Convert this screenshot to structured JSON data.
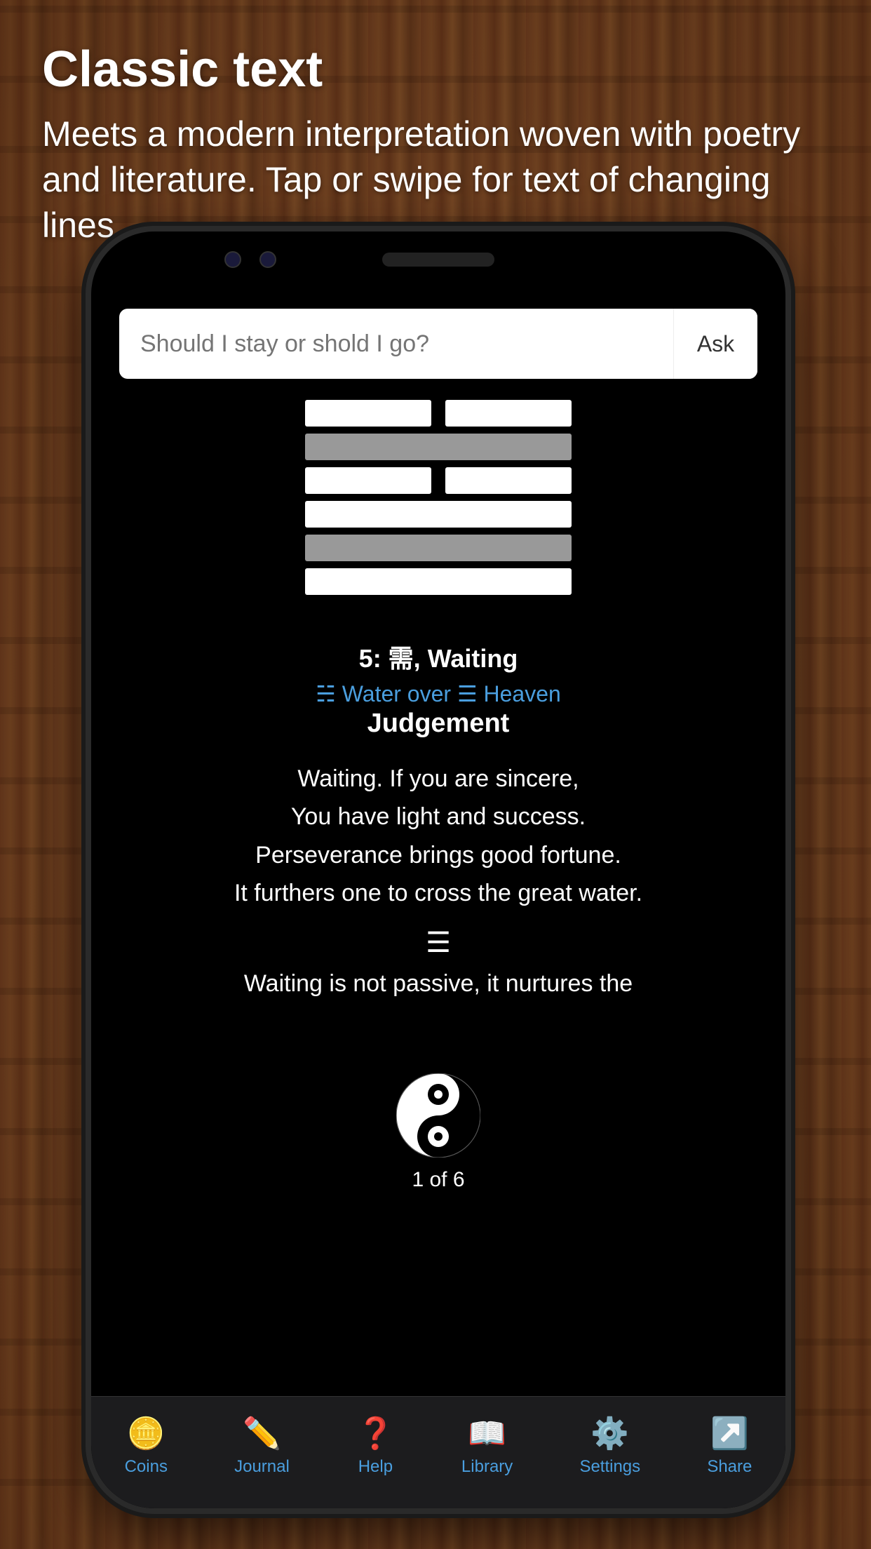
{
  "background": {
    "color": "#8B5E3C"
  },
  "header": {
    "title": "Classic text",
    "subtitle": "Meets a modern interpretation woven with poetry and literature. Tap or swipe for text of changing lines."
  },
  "search": {
    "placeholder": "Should I stay or shold I go?",
    "button_label": "Ask"
  },
  "hexagram": {
    "number": "5",
    "chinese": "需",
    "name": "Waiting",
    "upper_trigram": "Water",
    "lower_trigram": "Heaven",
    "upper_trigram_symbol": "☵",
    "lower_trigram_symbol": "☰",
    "lines_label": "5: 需, Waiting",
    "trigrams_label": "Water over  Heaven"
  },
  "judgement": {
    "title": "Judgement",
    "text_line1": "Waiting. If you are sincere,",
    "text_line2": "You have light and success.",
    "text_line3": "Perseverance brings good fortune.",
    "text_line4": "It furthers one to cross the great water.",
    "continuation": "Waiting is not passive, it nurtures the"
  },
  "pagination": {
    "current": "1",
    "total": "6",
    "label": "1 of 6"
  },
  "nav": {
    "items": [
      {
        "id": "coins",
        "label": "Coins",
        "icon": "🪙"
      },
      {
        "id": "journal",
        "label": "Journal",
        "icon": "✏️"
      },
      {
        "id": "help",
        "label": "Help",
        "icon": "❓"
      },
      {
        "id": "library",
        "label": "Library",
        "icon": "📖"
      },
      {
        "id": "settings",
        "label": "Settings",
        "icon": "⚙️"
      },
      {
        "id": "share",
        "label": "Share",
        "icon": "↗️"
      }
    ]
  }
}
